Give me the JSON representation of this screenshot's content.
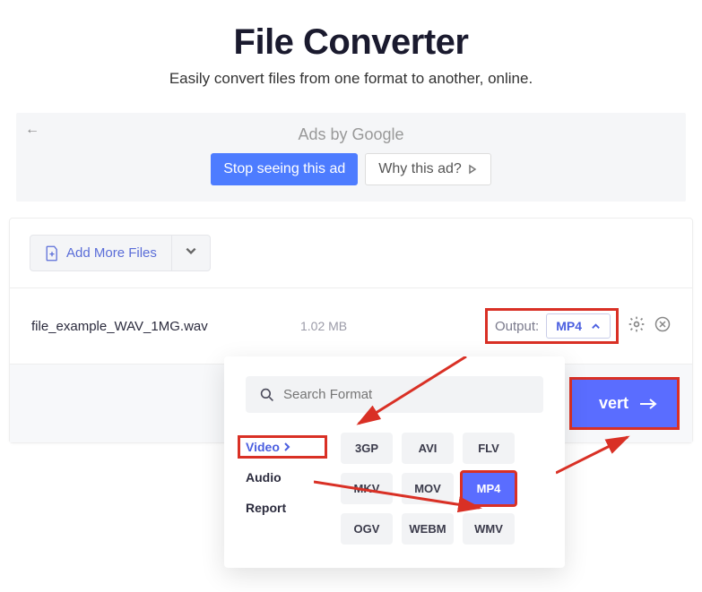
{
  "header": {
    "title": "File Converter",
    "subtitle": "Easily convert files from one format to another, online."
  },
  "ad": {
    "label": "Ads by Google",
    "stop": "Stop seeing this ad",
    "why": "Why this ad?"
  },
  "toolbar": {
    "add_more": "Add More Files"
  },
  "file": {
    "name": "file_example_WAV_1MG.wav",
    "size": "1.02 MB",
    "output_label": "Output:",
    "output_value": "MP4"
  },
  "convert": {
    "label": "vert"
  },
  "dropdown": {
    "search_placeholder": "Search Format",
    "categories": [
      "Video",
      "Audio",
      "Report"
    ],
    "formats": [
      "3GP",
      "AVI",
      "FLV",
      "MKV",
      "MOV",
      "MP4",
      "OGV",
      "WEBM",
      "WMV"
    ],
    "selected_format": "MP4"
  }
}
